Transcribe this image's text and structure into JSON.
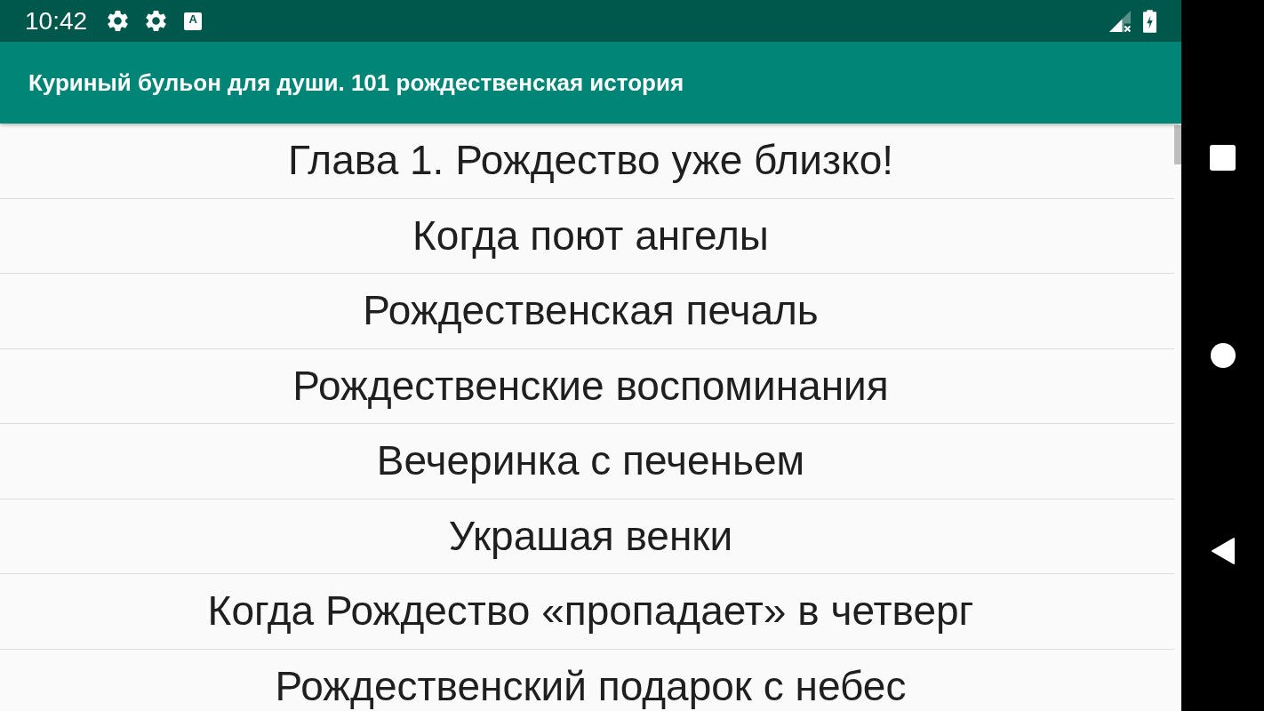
{
  "status_bar": {
    "time": "10:42",
    "input_icon_letter": "A"
  },
  "app_bar": {
    "title": "Куриный бульон для души. 101 рождественская история"
  },
  "chapters": [
    {
      "title": "Глава 1. Рождество уже близко!"
    },
    {
      "title": "Когда поют ангелы"
    },
    {
      "title": "Рождественская печаль"
    },
    {
      "title": "Рождественские воспоминания"
    },
    {
      "title": "Вечеринка с печеньем"
    },
    {
      "title": "Украшая венки"
    },
    {
      "title": "Когда Рождество «пропадает» в четверг"
    },
    {
      "title": "Рождественский подарок с небес"
    }
  ]
}
